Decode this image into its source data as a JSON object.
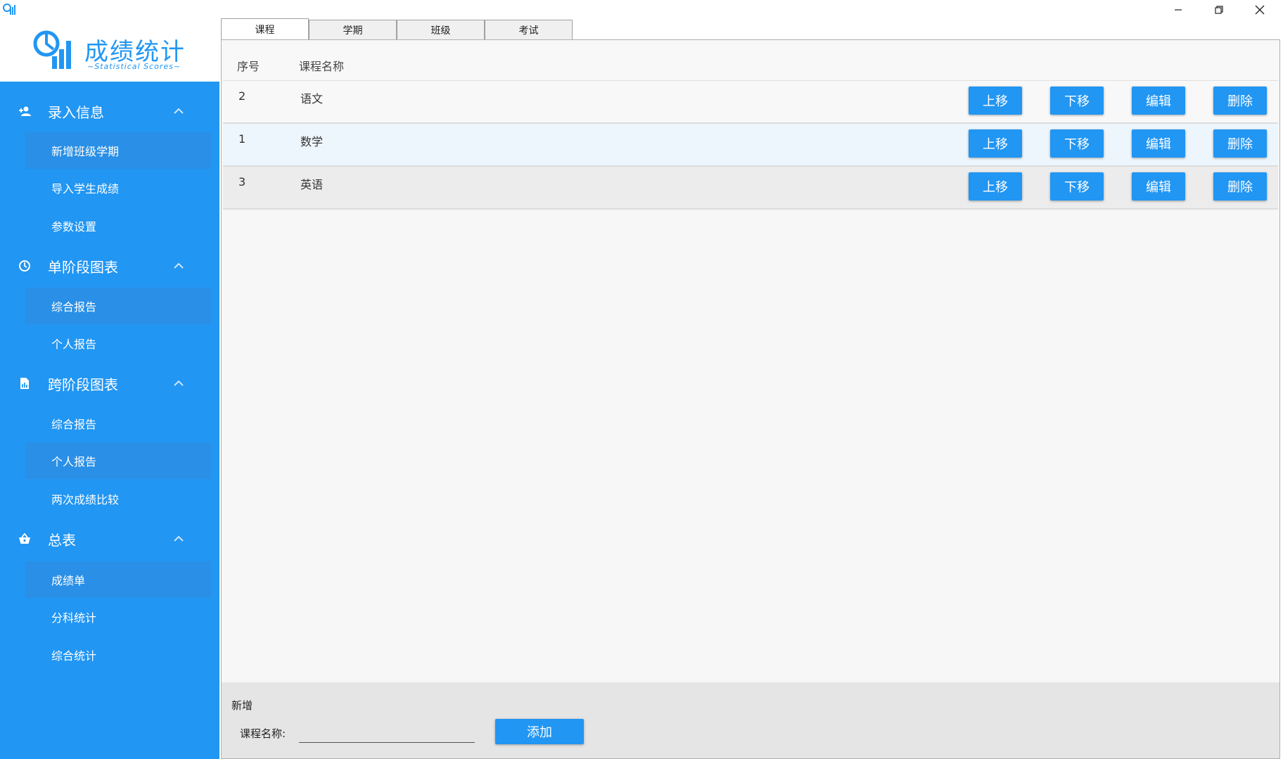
{
  "window": {
    "icons": {
      "app": "bar-chart-icon",
      "minimize": "minimize-icon",
      "restore": "restore-icon",
      "close": "close-icon"
    }
  },
  "logo": {
    "title": "成绩统计",
    "subtitle": "~Statistical Scores~"
  },
  "colors": {
    "accent": "#2196F3",
    "sidebar": "#2196F3"
  },
  "sidebar": {
    "groups": [
      {
        "label": "录入信息",
        "icon": "person-add-icon",
        "items": [
          {
            "label": "新增班级学期"
          },
          {
            "label": "导入学生成绩"
          },
          {
            "label": "参数设置"
          }
        ]
      },
      {
        "label": "单阶段图表",
        "icon": "clock-icon",
        "items": [
          {
            "label": "综合报告"
          },
          {
            "label": "个人报告"
          }
        ]
      },
      {
        "label": "跨阶段图表",
        "icon": "document-icon",
        "items": [
          {
            "label": "综合报告"
          },
          {
            "label": "个人报告"
          },
          {
            "label": "两次成绩比较"
          }
        ]
      },
      {
        "label": "总表",
        "icon": "basket-icon",
        "items": [
          {
            "label": "成绩单"
          },
          {
            "label": "分科统计"
          },
          {
            "label": "综合统计"
          }
        ]
      }
    ]
  },
  "tabs": [
    {
      "label": "课程"
    },
    {
      "label": "学期"
    },
    {
      "label": "班级"
    },
    {
      "label": "考试"
    }
  ],
  "table": {
    "headers": {
      "index": "序号",
      "name": "课程名称"
    },
    "rows": [
      {
        "index": "2",
        "name": "语文"
      },
      {
        "index": "1",
        "name": "数学"
      },
      {
        "index": "3",
        "name": "英语"
      }
    ],
    "actions": {
      "up": "上移",
      "down": "下移",
      "edit": "编辑",
      "delete": "删除"
    }
  },
  "add_form": {
    "title": "新增",
    "field_label": "课程名称:",
    "field_value": "",
    "button": "添加"
  }
}
